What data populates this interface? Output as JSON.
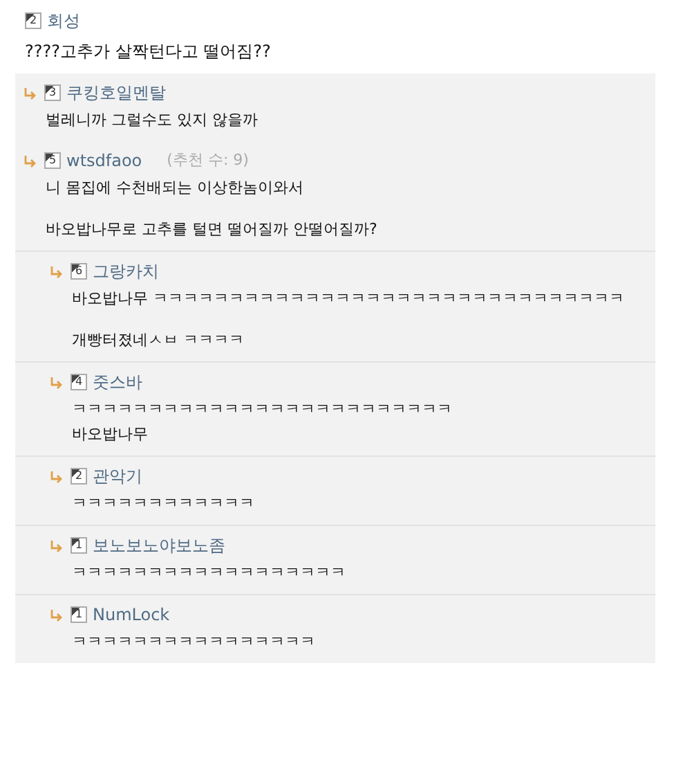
{
  "comment": {
    "level": "2",
    "author": "회성",
    "text": "????고추가 살짝턴다고 떨어짐??"
  },
  "replies": [
    {
      "level": "3",
      "author": "쿠킹호일멘탈",
      "paragraphs": [
        [
          "벌레니까 그럴수도 있지 않을까"
        ]
      ]
    },
    {
      "level": "5",
      "author": "wtsdfaoo",
      "votes": "(추천 수: 9)",
      "paragraphs": [
        [
          "니 몸집에 수천배되는 이상한놈이와서"
        ],
        [
          "바오밥나무로 고추를 털면 떨어질까 안떨어질까?"
        ]
      ],
      "children": [
        {
          "level": "6",
          "author": "그랑카치",
          "paragraphs": [
            [
              "바오밥나무 ㅋㅋㅋㅋㅋㅋㅋㅋㅋㅋㅋㅋㅋㅋㅋㅋㅋㅋㅋㅋㅋㅋㅋㅋㅋㅋㅋㅋㅋㅋㅋ"
            ],
            [
              "개빵터졌네ㅅㅂ ㅋㅋㅋㅋ"
            ]
          ]
        },
        {
          "level": "4",
          "author": "줏스바",
          "paragraphs": [
            [
              "ㅋㅋㅋㅋㅋㅋㅋㅋㅋㅋㅋㅋㅋㅋㅋㅋㅋㅋㅋㅋㅋㅋㅋㅋㅋ",
              "바오밥나무"
            ]
          ]
        },
        {
          "level": "2",
          "author": "관악기",
          "paragraphs": [
            [
              "ㅋㅋㅋㅋㅋㅋㅋㅋㅋㅋㅋㅋ"
            ]
          ]
        },
        {
          "level": "1",
          "author": "보노보노야보노좀",
          "paragraphs": [
            [
              "ㅋㅋㅋㅋㅋㅋㅋㅋㅋㅋㅋㅋㅋㅋㅋㅋㅋㅋ"
            ]
          ]
        },
        {
          "level": "1",
          "author": "NumLock",
          "paragraphs": [
            [
              "ㅋㅋㅋㅋㅋㅋㅋㅋㅋㅋㅋㅋㅋㅋㅋㅋ"
            ]
          ]
        }
      ]
    }
  ]
}
